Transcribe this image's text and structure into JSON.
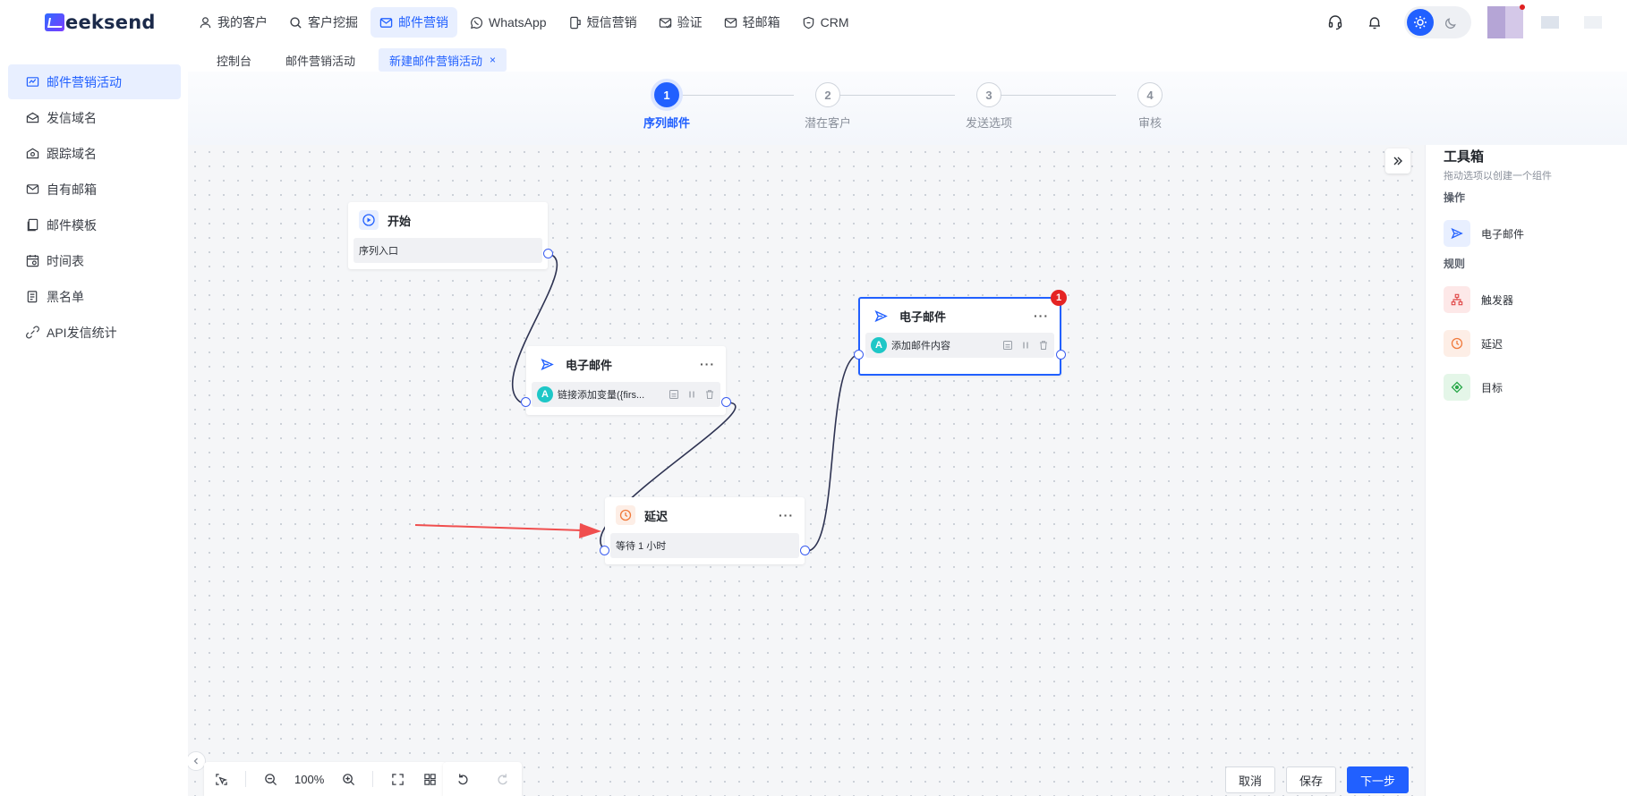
{
  "brand": {
    "logo_text": "eeksend"
  },
  "nav": {
    "items": [
      {
        "label": "我的客户",
        "icon": "user-icon"
      },
      {
        "label": "客户挖掘",
        "icon": "search-icon"
      },
      {
        "label": "邮件营销",
        "icon": "mail-icon",
        "active": true
      },
      {
        "label": "WhatsApp",
        "icon": "whatsapp-icon"
      },
      {
        "label": "短信营销",
        "icon": "sms-icon"
      },
      {
        "label": "验证",
        "icon": "verify-icon"
      },
      {
        "label": "轻邮箱",
        "icon": "light-mailbox-icon"
      },
      {
        "label": "CRM",
        "icon": "crm-icon"
      }
    ]
  },
  "tabs": [
    {
      "label": "控制台"
    },
    {
      "label": "邮件营销活动"
    },
    {
      "label": "新建邮件营销活动",
      "active": true,
      "close": "×"
    }
  ],
  "sidebar": {
    "items": [
      {
        "label": "邮件营销活动",
        "icon": "campaign-icon",
        "active": true
      },
      {
        "label": "发信域名",
        "icon": "sending-domain-icon"
      },
      {
        "label": "跟踪域名",
        "icon": "tracking-domain-icon"
      },
      {
        "label": "自有邮箱",
        "icon": "own-mailbox-icon"
      },
      {
        "label": "邮件模板",
        "icon": "template-icon"
      },
      {
        "label": "时间表",
        "icon": "schedule-icon"
      },
      {
        "label": "黑名单",
        "icon": "blacklist-icon"
      },
      {
        "label": "API发信统计",
        "icon": "api-stats-icon"
      }
    ]
  },
  "stepper": {
    "steps": [
      {
        "num": "1",
        "label": "序列邮件",
        "active": true
      },
      {
        "num": "2",
        "label": "潜在客户"
      },
      {
        "num": "3",
        "label": "发送选项"
      },
      {
        "num": "4",
        "label": "审核"
      }
    ]
  },
  "flow": {
    "start": {
      "title": "开始",
      "body": "序列入口"
    },
    "email1": {
      "title": "电子邮件",
      "more": "···",
      "avatar": "A",
      "body": "链接添加变量({firs..."
    },
    "delay": {
      "title": "延迟",
      "more": "···",
      "body": "等待 1 小时"
    },
    "email2": {
      "title": "电子邮件",
      "more": "···",
      "avatar": "A",
      "body": "添加邮件内容",
      "badge": "1"
    }
  },
  "zoom": {
    "value": "100%"
  },
  "actions": {
    "cancel": "取消",
    "save": "保存",
    "next": "下一步"
  },
  "toolbox": {
    "title": "工具箱",
    "subtitle": "拖动选项以创建一个组件",
    "groups": {
      "operations": "操作",
      "rules": "规则"
    },
    "items": {
      "email": "电子邮件",
      "trigger": "触发器",
      "delay": "延迟",
      "goal": "目标"
    }
  },
  "colors": {
    "primary": "#2160ff",
    "error": "#e52424",
    "annotation_arrow": "#f04e4e"
  }
}
